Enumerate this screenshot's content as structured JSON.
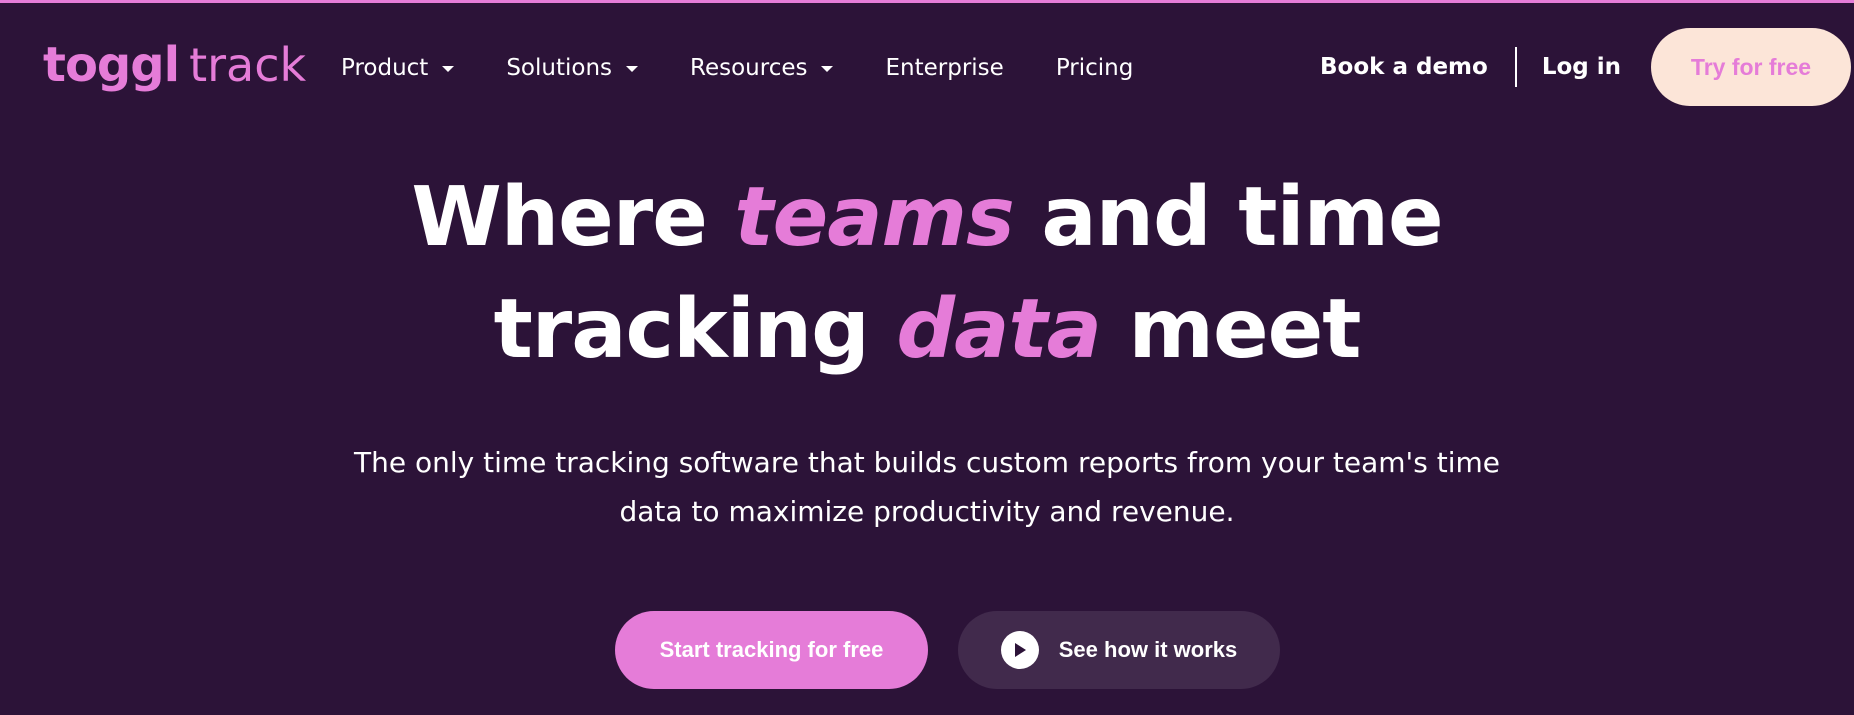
{
  "brand": {
    "logo_main": "toggl",
    "logo_sub": "track",
    "accent_color": "#e57cd8",
    "background_color": "#2c1338",
    "cta_secondary_bg": "#412a4c",
    "try_button_bg": "#fce5d8"
  },
  "nav": {
    "items": [
      {
        "label": "Product",
        "has_dropdown": true
      },
      {
        "label": "Solutions",
        "has_dropdown": true
      },
      {
        "label": "Resources",
        "has_dropdown": true
      },
      {
        "label": "Enterprise",
        "has_dropdown": false
      },
      {
        "label": "Pricing",
        "has_dropdown": false
      }
    ],
    "book_demo": "Book a demo",
    "login": "Log in",
    "try_free": "Try for free"
  },
  "hero": {
    "title_line1_pre": "Where ",
    "title_line1_accent": "teams",
    "title_line1_post": " and time",
    "title_line2_pre": "tracking ",
    "title_line2_accent": "data",
    "title_line2_post": " meet",
    "subtitle_line1": "The only time tracking software that builds custom reports from your team's time",
    "subtitle_line2": "data to maximize productivity and revenue.",
    "cta_primary": "Start tracking for free",
    "cta_secondary": "See how it works",
    "cta_secondary_icon": "play-icon"
  }
}
